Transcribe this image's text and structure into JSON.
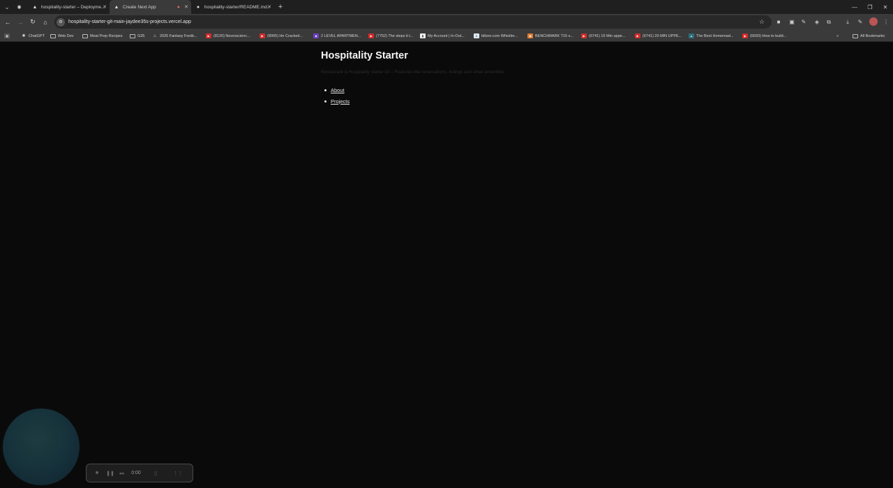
{
  "browser": {
    "tabs": [
      {
        "label": "",
        "icon": "record-icon",
        "pinned": true
      },
      {
        "label": "hospitality-starter – Deployme...",
        "icon": "vercel-icon"
      },
      {
        "label": "Create Next App",
        "icon": "vercel-icon",
        "active": true
      },
      {
        "label": "hospitality-starter/README.md...",
        "icon": "github-icon"
      }
    ],
    "address": "hospitality-starter-git-main-jaydee35s-projects.vercel.app"
  },
  "bookmarks": [
    {
      "label": "ChatGPT",
      "icon": "chatgpt-icon"
    },
    {
      "label": "Web Dev",
      "icon": "folder-icon"
    },
    {
      "label": "Meal Prep Recipes",
      "icon": "folder-icon"
    },
    {
      "label": "G35",
      "icon": "folder-icon"
    },
    {
      "label": "2025 Fantasy Footb...",
      "icon": "sleeper-icon"
    },
    {
      "label": "(8120) Neuroscienc...",
      "icon": "youtube-icon"
    },
    {
      "label": "(8065) He Cracked...",
      "icon": "youtube-icon"
    },
    {
      "label": "2 LEVEL APARTMEN...",
      "icon": "site-icon"
    },
    {
      "label": "(7752) The steps it t...",
      "icon": "youtube-icon"
    },
    {
      "label": "My Account | In-Out...",
      "icon": "site-icon"
    },
    {
      "label": "biltzer.com Whistler...",
      "icon": "site-icon"
    },
    {
      "label": "BENCHMARK T15 s...",
      "icon": "site-icon"
    },
    {
      "label": "(6741) 15 Min uppe...",
      "icon": "youtube-icon"
    },
    {
      "label": "(6741) 20 MIN UPPE...",
      "icon": "youtube-icon"
    },
    {
      "label": "The Best Homemad...",
      "icon": "site-icon"
    },
    {
      "label": "(6693) How to build...",
      "icon": "youtube-icon"
    },
    {
      "label": "All Bookmarks",
      "icon": "folder-icon"
    }
  ],
  "page": {
    "title": "Hospitality Starter",
    "subtitle": "Restaurant & Hospitality starter kit – Features like reservations, listings and other amenities.",
    "links": [
      "About",
      "Projects"
    ]
  },
  "recorder": {
    "time": "0:00"
  }
}
